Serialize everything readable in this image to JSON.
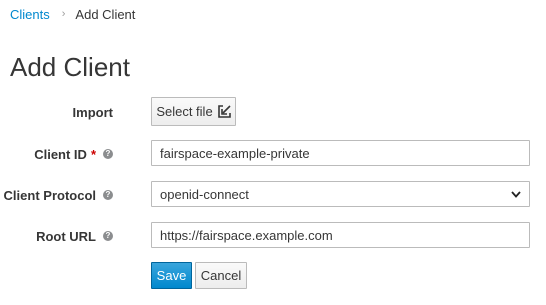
{
  "breadcrumb": {
    "parent": "Clients",
    "separator": "›",
    "current": "Add Client"
  },
  "page_title": "Add Client",
  "form": {
    "import": {
      "label": "Import",
      "button_label": "Select file",
      "icon": "import-icon"
    },
    "client_id": {
      "label": "Client ID",
      "required_mark": "*",
      "value": "fairspace-example-private",
      "help_icon": "help-icon"
    },
    "client_protocol": {
      "label": "Client Protocol",
      "value": "openid-connect",
      "help_icon": "help-icon"
    },
    "root_url": {
      "label": "Root URL",
      "value": "https://fairspace.example.com",
      "help_icon": "help-icon"
    }
  },
  "actions": {
    "save_label": "Save",
    "cancel_label": "Cancel"
  },
  "colors": {
    "link": "#0088ce",
    "primary": "#0088ce",
    "required": "#cc0000"
  }
}
